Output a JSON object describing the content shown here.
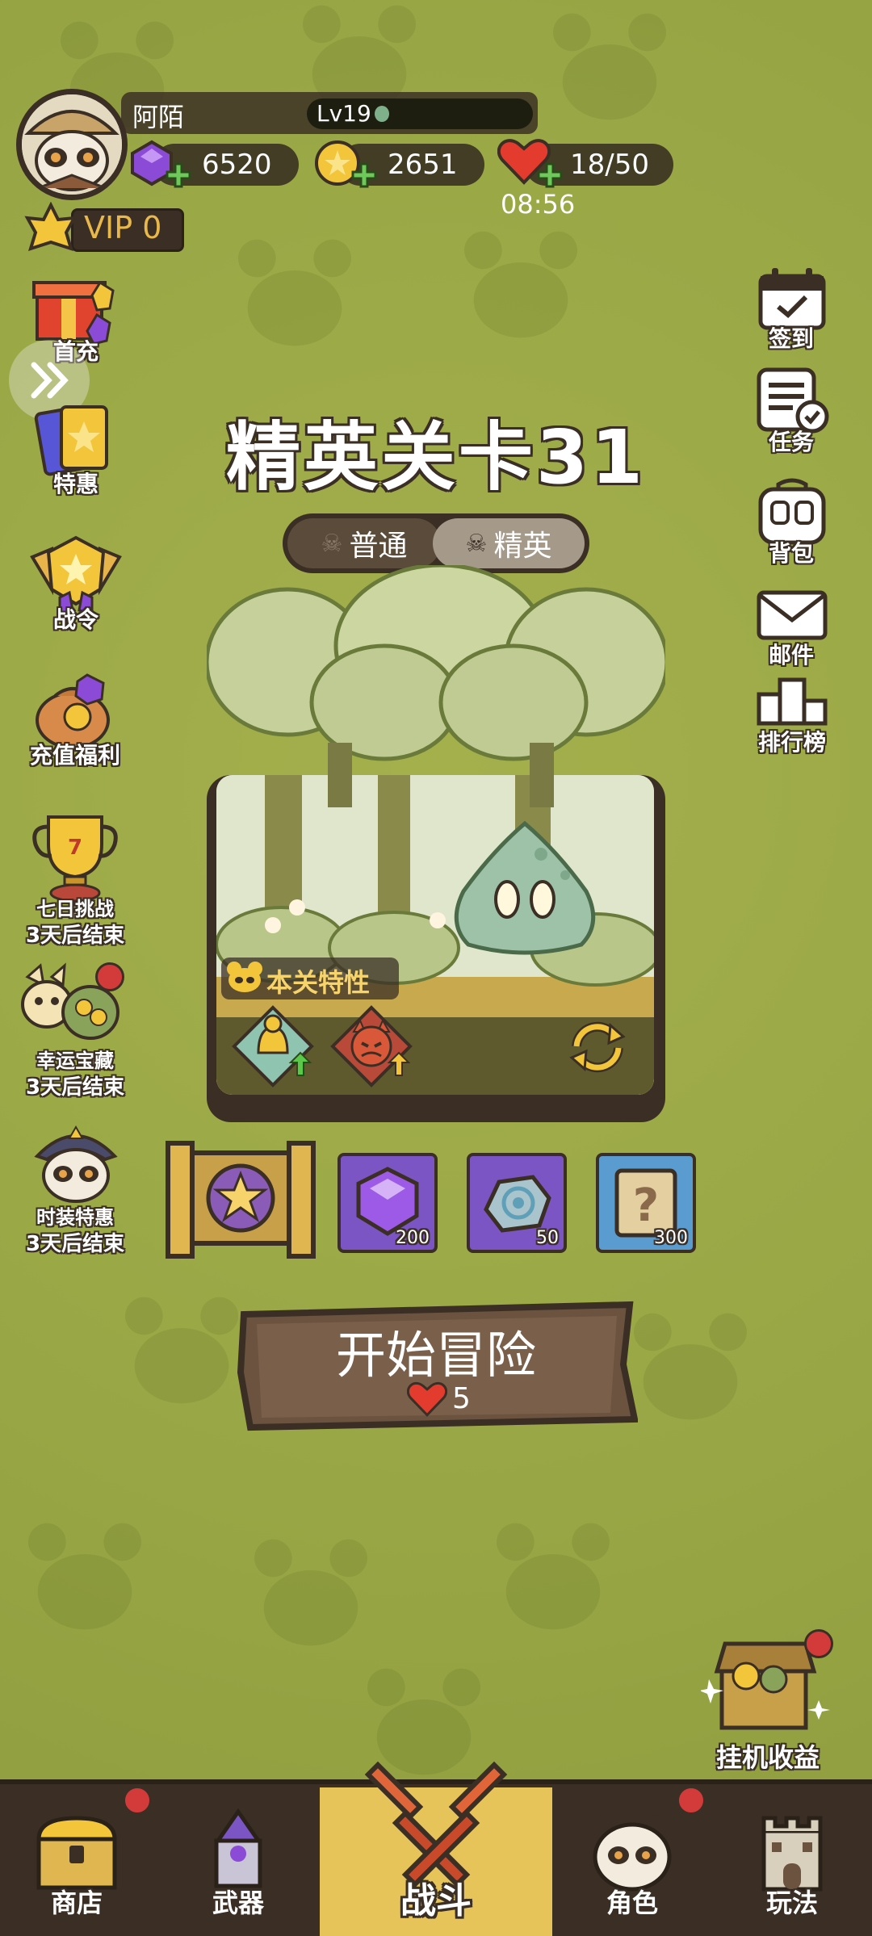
{
  "player": {
    "name": "阿陌",
    "level": "Lv19",
    "vip": "VIP 0"
  },
  "resources": {
    "gems": "6520",
    "coins": "2651",
    "stamina": "18/50",
    "stamina_timer": "08:56"
  },
  "left_menu": {
    "first_charge": "首充",
    "special_offer": "特惠",
    "battle_pass": "战令",
    "recharge_bonus": "充值福利",
    "seven_day": {
      "title": "七日挑战",
      "remaining": "3天后结束"
    },
    "lucky_treasure": {
      "title": "幸运宝藏",
      "remaining": "3天后结束"
    },
    "costume_offer": {
      "title": "时装特惠",
      "remaining": "3天后结束"
    }
  },
  "right_menu": {
    "checkin": "签到",
    "tasks": "任务",
    "backpack": "背包",
    "mail": "邮件",
    "ranking": "排行榜"
  },
  "stage": {
    "title": "精英关卡31",
    "tabs": [
      {
        "label": "普通"
      },
      {
        "label": "精英"
      }
    ],
    "feature_label": "本关特性"
  },
  "rewards": [
    {
      "icon": "star-chest-icon",
      "count": ""
    },
    {
      "icon": "purple-gem-icon",
      "count": "200"
    },
    {
      "icon": "stone-icon",
      "count": "50"
    },
    {
      "icon": "mystery-scroll-icon",
      "count": "300"
    }
  ],
  "start": {
    "label": "开始冒险",
    "cost": "5"
  },
  "idle_reward": "挂机收益",
  "nav": {
    "shop": "商店",
    "weapons": "武器",
    "battle": "战斗",
    "character": "角色",
    "gameplay": "玩法"
  },
  "colors": {
    "primary_bg": "#9aa846",
    "dark_brown": "#3b2f25",
    "gold": "#e6c45a",
    "red_dot": "#d33b3b"
  }
}
